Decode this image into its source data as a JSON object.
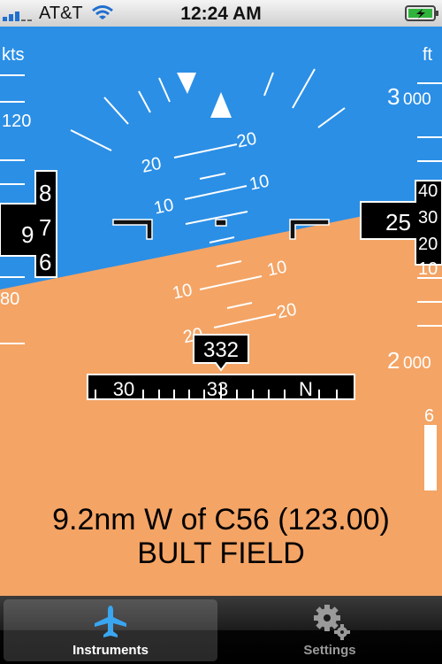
{
  "status_bar": {
    "carrier": "AT&T",
    "time": "12:24 AM",
    "icons": [
      "signal-bars-icon",
      "wifi-icon",
      "battery-charging-icon"
    ]
  },
  "colors": {
    "sky": "#2c8fe6",
    "ground": "#f4a465",
    "marks": "#ffffff",
    "tape_box": "#000000",
    "tab_active": "#ffffff",
    "tab_inactive": "#9a9a9a",
    "plane_icon": "#3aa6f0"
  },
  "speed_tape": {
    "unit": "kts",
    "labels": [
      "120",
      "80"
    ],
    "readout_tens": "9",
    "readout_ones": [
      "8",
      "7",
      "6"
    ]
  },
  "altitude_tape": {
    "unit": "ft",
    "labels": [
      {
        "big": "3",
        "small": "000"
      },
      {
        "big": "2",
        "small": "000"
      }
    ],
    "readout_hundreds": "25",
    "readout_tens": [
      "40",
      "30",
      "20",
      "10"
    ]
  },
  "pitch_ladder": {
    "sky_labels": [
      "20",
      "20",
      "10",
      "10"
    ],
    "ground_labels": [
      "10",
      "10",
      "20",
      "20"
    ]
  },
  "heading": {
    "value": "332",
    "scale_labels": [
      "30",
      "33",
      "N"
    ]
  },
  "vertical_speed": {
    "label": "6"
  },
  "location": {
    "line1": "9.2nm W of C56 (123.00)",
    "line2": "BULT FIELD"
  },
  "tabs": [
    {
      "label": "Instruments",
      "icon": "airplane-icon",
      "selected": true
    },
    {
      "label": "Settings",
      "icon": "gear-icon",
      "selected": false
    }
  ]
}
